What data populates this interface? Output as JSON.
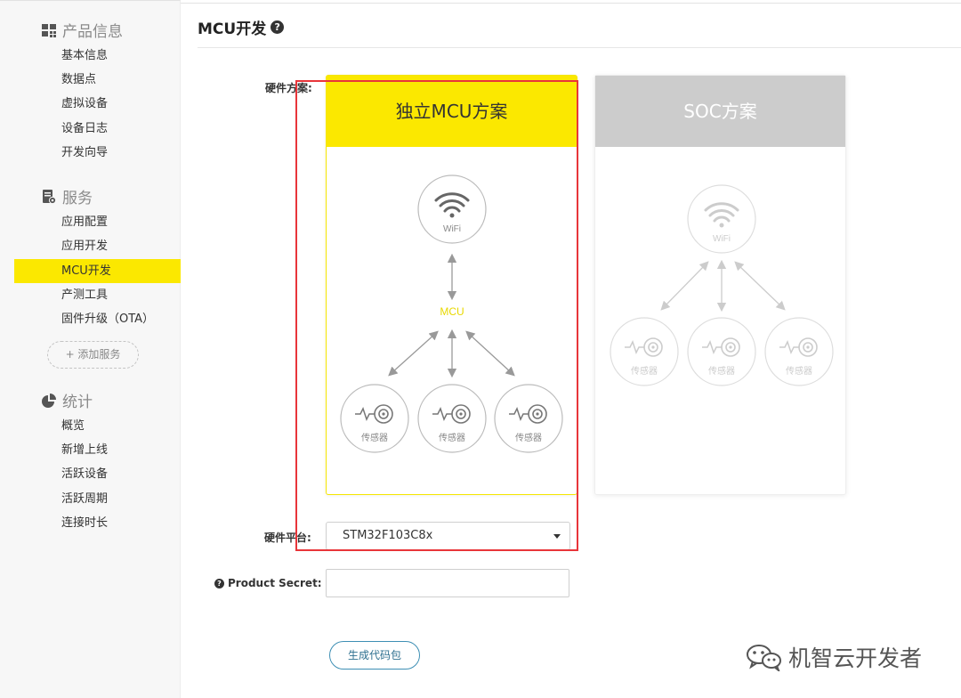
{
  "sidebar": {
    "product_info": {
      "title": "产品信息",
      "items": [
        "基本信息",
        "数据点",
        "虚拟设备",
        "设备日志",
        "开发向导"
      ]
    },
    "services": {
      "title": "服务",
      "items": [
        "应用配置",
        "应用开发",
        "MCU开发",
        "产测工具",
        "固件升级（OTA）"
      ],
      "active": "MCU开发",
      "add_button": "+ 添加服务"
    },
    "stats": {
      "title": "统计",
      "items": [
        "概览",
        "新增上线",
        "活跃设备",
        "活跃周期",
        "连接时长"
      ]
    }
  },
  "main": {
    "title": "MCU开发",
    "help_icon": "question-circle-icon",
    "hardware_label": "硬件方案:",
    "cards": {
      "mcu": {
        "title": "独立MCU方案",
        "wifi_label": "WiFi",
        "mcu_label": "MCU",
        "sensor_label": "传感器"
      },
      "soc": {
        "title": "SOC方案",
        "wifi_label": "WiFi",
        "sensor_label": "传感器"
      }
    },
    "platform_label": "硬件平台:",
    "platform_value": "STM32F103C8x",
    "product_secret_label": "Product Secret:",
    "product_secret_value": "",
    "generate_button": "生成代码包"
  },
  "watermark": {
    "text": "机智云开发者",
    "icon": "wechat-icon"
  },
  "colors": {
    "accent_yellow": "#fbe800",
    "soc_gray": "#cccccc",
    "highlight_red": "#e8353a",
    "button_blue": "#3e8fb4"
  }
}
